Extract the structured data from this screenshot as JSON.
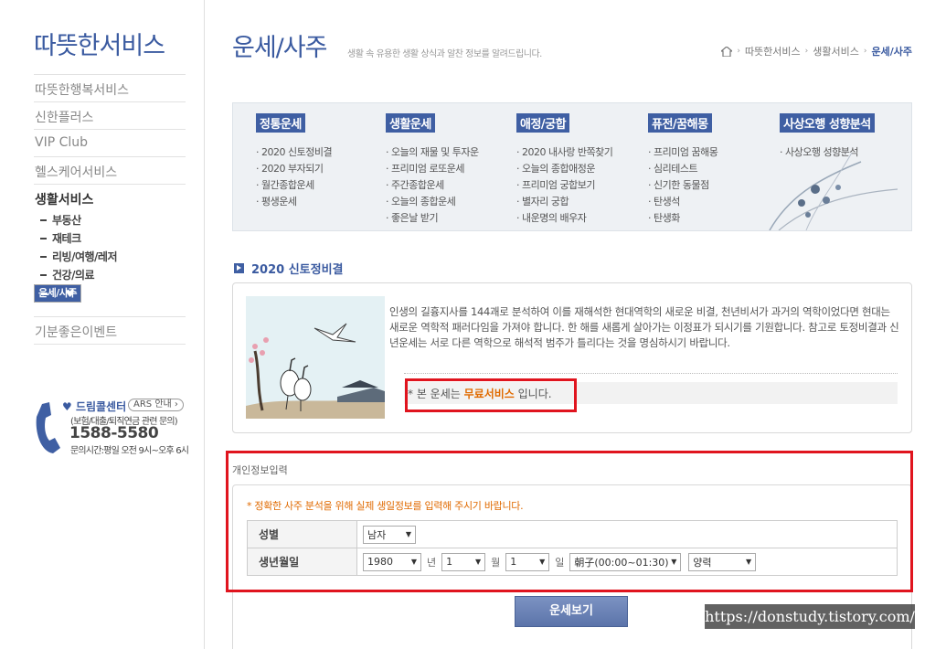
{
  "sidebar": {
    "brand": "따뜻한서비스",
    "nav": [
      "따뜻한행복서비스",
      "신한플러스",
      "VIP Club",
      "헬스케어서비스"
    ],
    "active": "생활서비스",
    "sub_items": [
      "부동산",
      "재테크",
      "리빙/여행/레저",
      "건강/의료",
      "운세/사주"
    ],
    "after": "기분좋은이벤트",
    "callcenter": {
      "title": "드림콜센터",
      "ars": "ARS 안내",
      "desc": "(보험/대출/퇴직연금 관련 문의)",
      "number": "1588-5580",
      "hours": "문의시간:평일 오전 9시~오후 6시"
    }
  },
  "header": {
    "title": "운세/사주",
    "subtitle": "생활 속 유용한 생활 상식과 알찬 정보를 알려드립니다.",
    "breadcrumb": [
      "따뜻한서비스",
      "생활서비스",
      "운세/사주"
    ]
  },
  "categories": [
    {
      "head": "정통운세",
      "items": [
        "2020 신토정비결",
        "2020 부자되기",
        "월간종합운세",
        "평생운세"
      ]
    },
    {
      "head": "생활운세",
      "items": [
        "오늘의 재물 및 투자운",
        "프리미엄 로또운세",
        "주간종합운세",
        "오늘의 종합운세",
        "좋은날 받기"
      ]
    },
    {
      "head": "애정/궁합",
      "items": [
        "2020 내사랑 반쪽찾기",
        "오늘의 종합애정운",
        "프리미엄 궁합보기",
        "별자리 궁합",
        "내운명의 배우자"
      ]
    },
    {
      "head": "퓨전/꿈해몽",
      "items": [
        "프리미엄 꿈해몽",
        "심리테스트",
        "신기한 동물점",
        "탄생석",
        "탄생화"
      ]
    },
    {
      "head": "사상오행 성향분석",
      "items": [
        "사상오행 성향분석"
      ]
    }
  ],
  "section": {
    "title": "2020 신토정비결",
    "intro": "인생의 길흉지사를 144괘로 분석하여 이를 재해석한 현대역학의 새로운 비결, 천년비서가 과거의 역학이었다면 현대는 새로운 역학적 패러다임을 가져야 합니다. 한 해를 새롭게 살아가는 이정표가 되시기를 기원합니다. 참고로 토정비결과 신년운세는 서로 다른 역학으로 해석적 범주가 틀리다는 것을 명심하시기 바랍니다.",
    "free_prefix": "* 본 운세는 ",
    "free_highlight": "무료서비스",
    "free_suffix": " 입니다."
  },
  "personal": {
    "title": "개인정보입력",
    "note": "* 정확한 사주 분석을 위해 실제 생일정보를 입력해 주시기 바랍니다.",
    "gender_label": "성별",
    "gender_value": "남자",
    "birth_label": "생년월일",
    "year": "1980",
    "year_unit": "년",
    "month": "1",
    "month_unit": "월",
    "day": "1",
    "day_unit": "일",
    "hour": "朝子(00:00~01:30)",
    "calendar": "양력",
    "submit": "운세보기"
  },
  "watermark": "https://donstudy.tistory.com/"
}
